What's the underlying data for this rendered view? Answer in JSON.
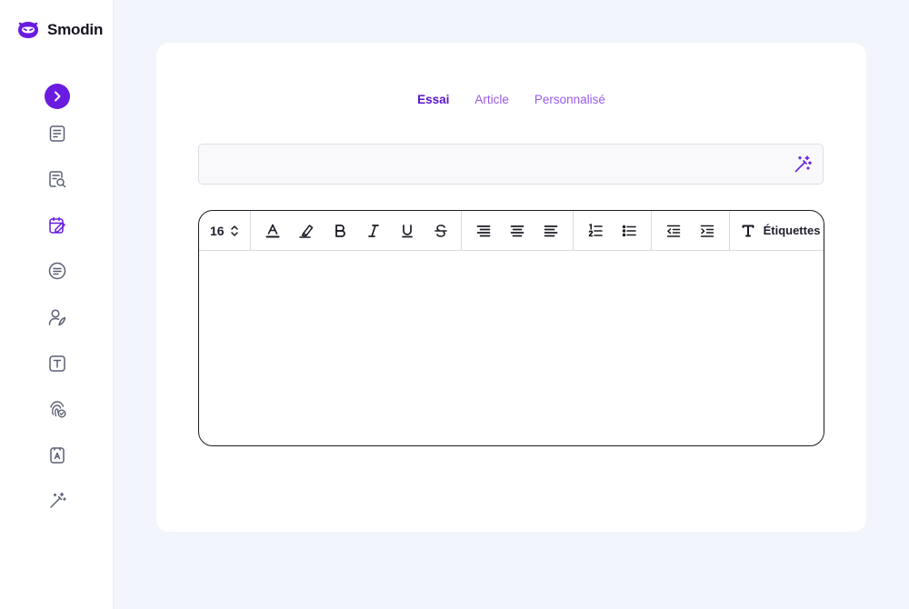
{
  "brand": {
    "name": "Smodin",
    "color": "#6a1be0"
  },
  "sidebar": {
    "items": [
      {
        "icon": "chevron-right-icon"
      },
      {
        "icon": "document-lines-icon"
      },
      {
        "icon": "document-search-icon"
      },
      {
        "icon": "calendar-edit-icon"
      },
      {
        "icon": "circle-lines-icon"
      },
      {
        "icon": "user-feather-icon"
      },
      {
        "icon": "text-box-icon"
      },
      {
        "icon": "fingerprint-check-icon"
      },
      {
        "icon": "ai-document-icon"
      },
      {
        "icon": "magic-wand-icon"
      }
    ]
  },
  "tabs": [
    {
      "label": "Essai",
      "active": true
    },
    {
      "label": "Article",
      "active": false
    },
    {
      "label": "Personnalisé",
      "active": false
    }
  ],
  "topic_input": {
    "value": "",
    "placeholder": ""
  },
  "toolbar": {
    "font_size": "16",
    "tags_label": "Étiquettes"
  },
  "editor": {
    "content": ""
  },
  "colors": {
    "accent": "#6a1be0",
    "tab_inactive": "#9a5ae9",
    "page_bg": "#f3f5fc"
  }
}
